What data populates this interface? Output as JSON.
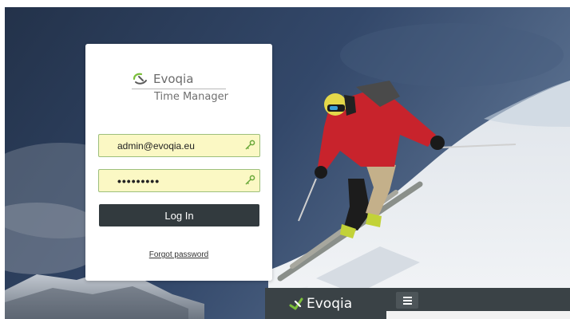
{
  "brand": {
    "name": "Evoqia",
    "subtitle": "Time Manager"
  },
  "login": {
    "email_value": "admin@evoqia.eu",
    "password_value": "•••••••••",
    "submit_label": "Log In",
    "forgot_label": "Forgot password"
  },
  "bottom_bar": {
    "brand": "Evoqia"
  },
  "colors": {
    "field_bg": "#fbf8c4",
    "button_bg": "#323a3e",
    "bar_bg": "#3a4246",
    "accent_green": "#7bbf3a"
  },
  "icons": {
    "key": "key-icon",
    "logo": "evoqia-logo-icon",
    "menu": "hamburger-menu-icon"
  }
}
